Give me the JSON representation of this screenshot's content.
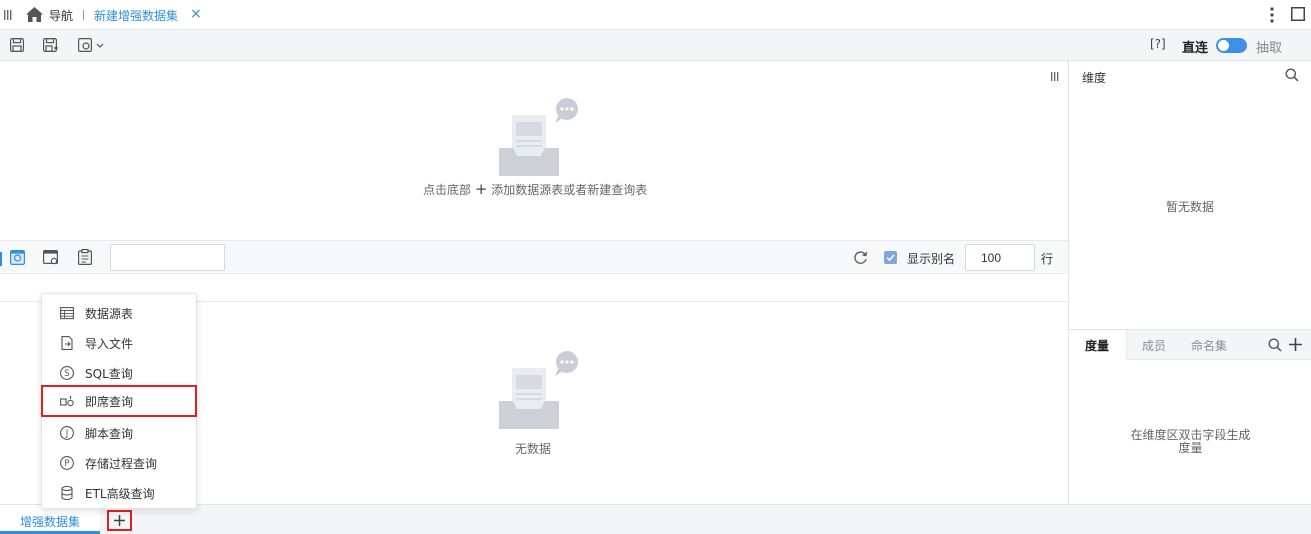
{
  "tabs": {
    "nav_label": "导航",
    "active_label": "新建增强数据集",
    "close_glyph": "×"
  },
  "toolbar": {
    "help_label": "[?]",
    "direct_label": "直连",
    "extract_label": "抽取",
    "mode_toggle_on": true
  },
  "canvas": {
    "empty_prefix": "点击底部",
    "empty_plus": "+",
    "empty_suffix": "添加数据源表或者新建查询表"
  },
  "preview": {
    "search_value": "",
    "show_alias_label": "显示别名",
    "show_alias_checked": true,
    "rows_value": "100",
    "rows_unit": "行",
    "empty_label": "无数据"
  },
  "right_panel": {
    "dimension_title": "维度",
    "dimension_empty": "暂无数据",
    "measure_tabs": [
      "度量",
      "成员",
      "命名集"
    ],
    "measure_empty_line1": "在维度区双击字段生成",
    "measure_empty_line2": "度量"
  },
  "menu": {
    "items": [
      {
        "label": "数据源表",
        "icon": "table-icon"
      },
      {
        "label": "导入文件",
        "icon": "import-file-icon"
      },
      {
        "label": "SQL查询",
        "icon": "sql-query-icon"
      },
      {
        "label": "即席查询",
        "icon": "adhoc-query-icon"
      },
      {
        "label": "脚本查询",
        "icon": "script-query-icon"
      },
      {
        "label": "存储过程查询",
        "icon": "stored-procedure-icon"
      },
      {
        "label": "ETL高级查询",
        "icon": "etl-query-icon"
      }
    ],
    "selected_index": 3
  },
  "bottom": {
    "tab_label": "增强数据集",
    "add_glyph": "+"
  },
  "colors": {
    "accent": "#2f8fdc",
    "highlight_border": "#e02020",
    "toggle": "#3d8fe8"
  }
}
